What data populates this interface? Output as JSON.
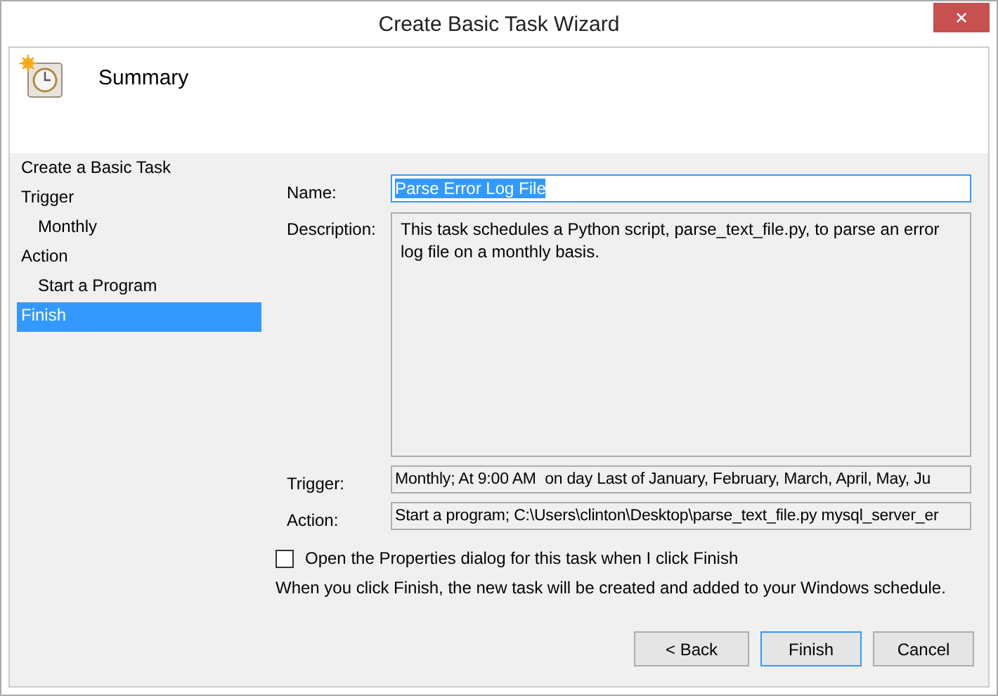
{
  "window": {
    "title": "Create Basic Task Wizard",
    "close": "✕"
  },
  "header": {
    "title": "Summary"
  },
  "steps": [
    {
      "label": "Create a Basic Task",
      "selected": false
    },
    {
      "label": "Trigger",
      "selected": false,
      "children": [
        {
          "label": "Monthly",
          "selected": false
        }
      ]
    },
    {
      "label": "Action",
      "selected": false,
      "children": [
        {
          "label": "Start a Program",
          "selected": false
        }
      ]
    },
    {
      "label": "Finish",
      "selected": true
    }
  ],
  "form": {
    "name_label": "Name:",
    "name": "Parse Error Log File",
    "description_label": "Description:",
    "description": "This task schedules a Python script, parse_text_file.py, to parse an error log file on a monthly basis.",
    "trigger_label": "Trigger:",
    "trigger": "Monthly; At 9:00 AM  on day Last of January, February, March, April, May, Ju",
    "action_label": "Action:",
    "action": "Start a program; C:\\Users\\clinton\\Desktop\\parse_text_file.py mysql_server_er"
  },
  "open_properties": {
    "label": "Open the Properties dialog for this task when I click Finish",
    "checked": false
  },
  "note": "When you click Finish, the new task will be created and added to your Windows schedule.",
  "buttons": [
    {
      "label": "< Back",
      "default": false
    },
    {
      "label": "Finish",
      "default": true
    },
    {
      "label": "Cancel",
      "default": false
    }
  ]
}
